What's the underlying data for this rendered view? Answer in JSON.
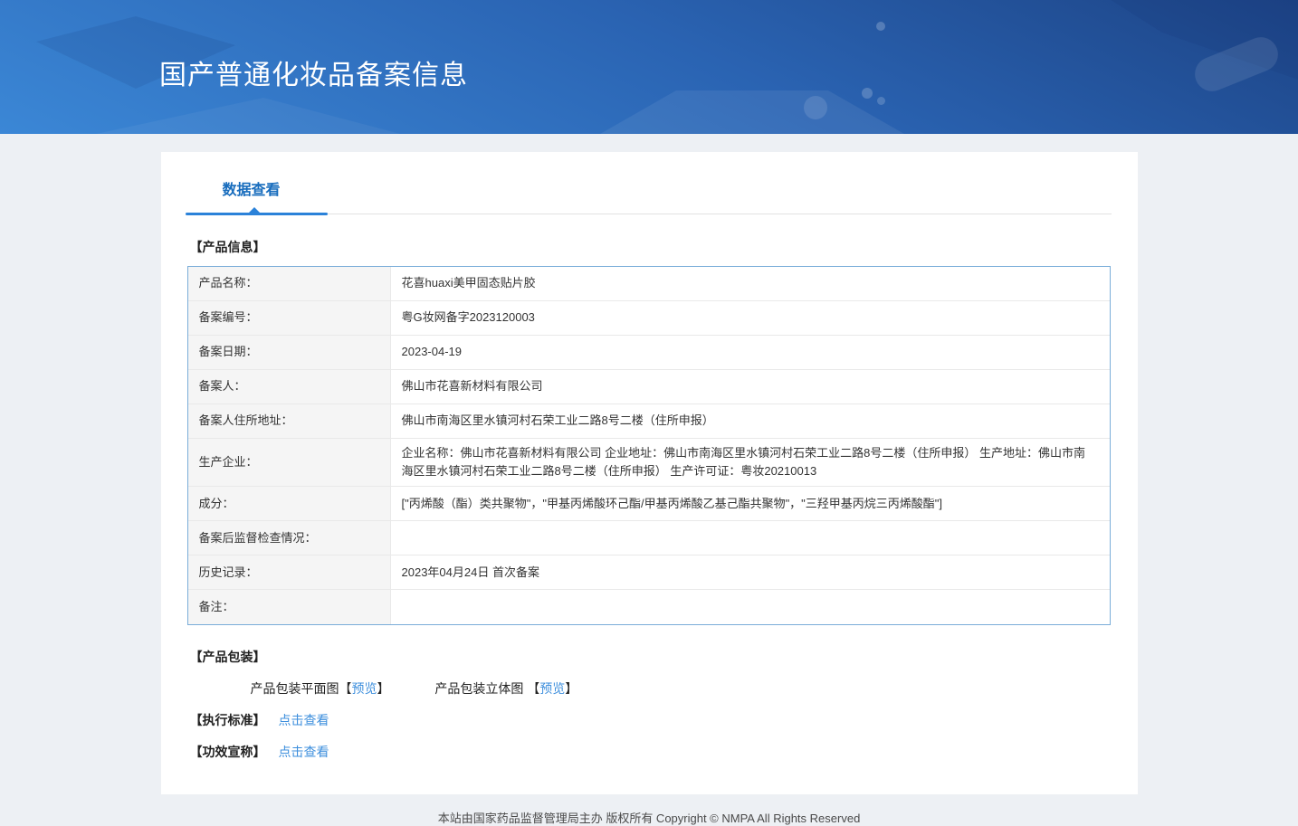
{
  "header": {
    "title": "国产普通化妆品备案信息"
  },
  "tabs": {
    "data_view": "数据查看"
  },
  "product_info": {
    "section_title": "【产品信息】",
    "rows": [
      {
        "label": "产品名称：",
        "value": "花喜huaxi美甲固态贴片胶"
      },
      {
        "label": "备案编号：",
        "value": "粤G妆网备字2023120003"
      },
      {
        "label": "备案日期：",
        "value": "2023-04-19"
      },
      {
        "label": "备案人：",
        "value": "佛山市花喜新材料有限公司"
      },
      {
        "label": "备案人住所地址：",
        "value": "佛山市南海区里水镇河村石荣工业二路8号二楼（住所申报）"
      },
      {
        "label": "生产企业：",
        "value": "企业名称：佛山市花喜新材料有限公司 企业地址：佛山市南海区里水镇河村石荣工业二路8号二楼（住所申报） 生产地址：佛山市南海区里水镇河村石荣工业二路8号二楼（住所申报） 生产许可证：粤妆20210013"
      },
      {
        "label": "成分：",
        "value": "[\"丙烯酸（酯）类共聚物\"，\"甲基丙烯酸环己酯/甲基丙烯酸乙基己酯共聚物\"，\"三羟甲基丙烷三丙烯酸酯\"]"
      },
      {
        "label": "备案后监督检查情况：",
        "value": ""
      },
      {
        "label": "历史记录：",
        "value": "2023年04月24日 首次备案"
      },
      {
        "label": "备注：",
        "value": ""
      }
    ]
  },
  "packaging": {
    "section_title": "【产品包装】",
    "items": [
      {
        "label": "产品包装平面图",
        "open": "【",
        "link": "预览",
        "close": "】"
      },
      {
        "label": "产品包装立体图 ",
        "open": "【",
        "link": "预览",
        "close": "】"
      }
    ]
  },
  "standards": {
    "label": "【执行标准】",
    "link": "点击查看"
  },
  "efficacy": {
    "label": "【功效宣称】",
    "link": "点击查看"
  },
  "footer": {
    "text": "本站由国家药品监督管理局主办 版权所有 Copyright © NMPA All Rights Reserved"
  },
  "colors": {
    "accent_blue": "#2b82d9",
    "link_blue": "#3e8fdd",
    "tab_blue": "#176cbd",
    "table_border": "#7aadd9",
    "header_top": "#1d4486",
    "header_bottom": "#3b87d6"
  }
}
